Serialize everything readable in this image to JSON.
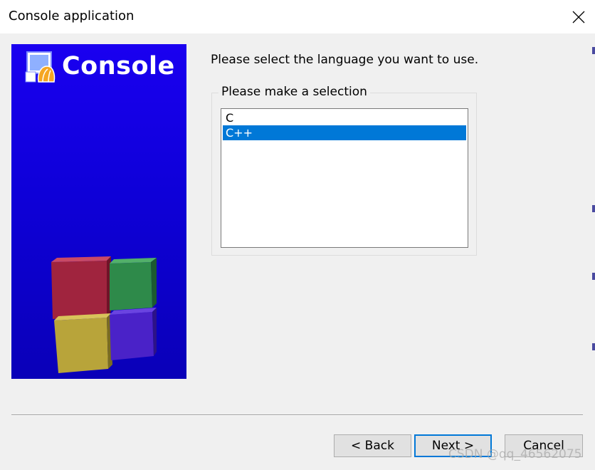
{
  "window": {
    "title": "Console application",
    "close_icon": "close-icon"
  },
  "banner": {
    "title": "Console",
    "colors": {
      "background": "#1200e0",
      "text": "#ffffff"
    },
    "logo_icon": "codeblocks-logo-icon",
    "art": "colored-cubes"
  },
  "main": {
    "prompt": "Please select the language you want to use.",
    "group_label": "Please make a selection",
    "languages": [
      {
        "label": "C",
        "selected": false
      },
      {
        "label": "C++",
        "selected": true
      }
    ],
    "selection_color": "#0078d7"
  },
  "footer": {
    "back_label": "< Back",
    "next_label": "Next >",
    "cancel_label": "Cancel"
  },
  "watermark": "CSDN @qq_46562075"
}
